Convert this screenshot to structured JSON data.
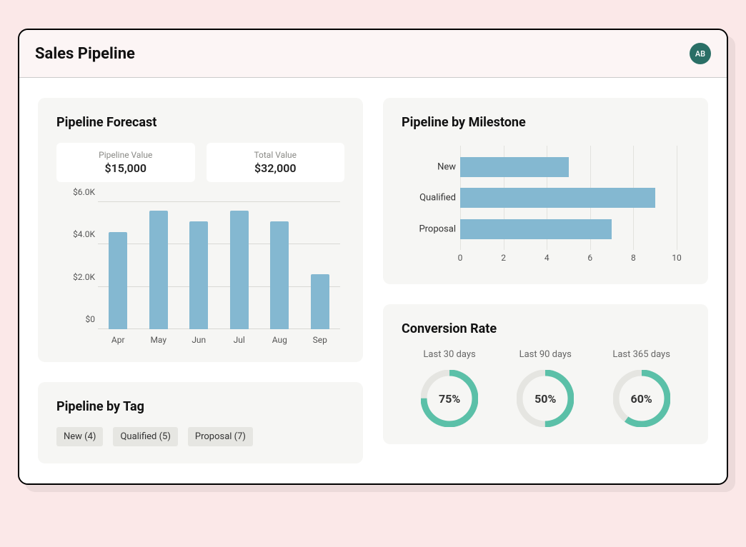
{
  "header": {
    "title": "Sales Pipeline",
    "avatar_initials": "AB"
  },
  "forecast": {
    "title": "Pipeline Forecast",
    "stats": [
      {
        "label": "Pipeline Value",
        "value": "$15,000"
      },
      {
        "label": "Total Value",
        "value": "$32,000"
      }
    ]
  },
  "by_tag": {
    "title": "Pipeline by Tag",
    "tags": [
      {
        "label": "New (4)"
      },
      {
        "label": "Qualified (5)"
      },
      {
        "label": "Proposal (7)"
      }
    ]
  },
  "by_milestone": {
    "title": "Pipeline by Milestone"
  },
  "conversion": {
    "title": "Conversion Rate",
    "items": [
      {
        "label": "Last 30 days",
        "percent": 75,
        "text": "75%"
      },
      {
        "label": "Last 90 days",
        "percent": 50,
        "text": "50%"
      },
      {
        "label": "Last 365 days",
        "percent": 60,
        "text": "60%"
      }
    ]
  },
  "colors": {
    "bar": "#84b8d1",
    "ring": "#5bc0a8",
    "ring_track": "#e5e5e1",
    "avatar_bg": "#2a6f66"
  },
  "chart_data": [
    {
      "id": "forecast_bar",
      "type": "bar",
      "title": "Pipeline Forecast",
      "categories": [
        "Apr",
        "May",
        "Jun",
        "Jul",
        "Aug",
        "Sep"
      ],
      "values": [
        4600,
        5600,
        5100,
        5600,
        5100,
        2600
      ],
      "ylabel": "",
      "ylim": [
        0,
        6000
      ],
      "yticks": [
        0,
        2000,
        4000,
        6000
      ],
      "ytick_labels": [
        "$0",
        "$2.0K",
        "$4.0K",
        "$6.0K"
      ]
    },
    {
      "id": "milestone_hbar",
      "type": "bar",
      "orientation": "horizontal",
      "title": "Pipeline by Milestone",
      "categories": [
        "New",
        "Qualified",
        "Proposal"
      ],
      "values": [
        5.0,
        9.0,
        7.0
      ],
      "xlim": [
        0,
        10
      ],
      "xticks": [
        0,
        2,
        4,
        6,
        8,
        10
      ]
    }
  ]
}
